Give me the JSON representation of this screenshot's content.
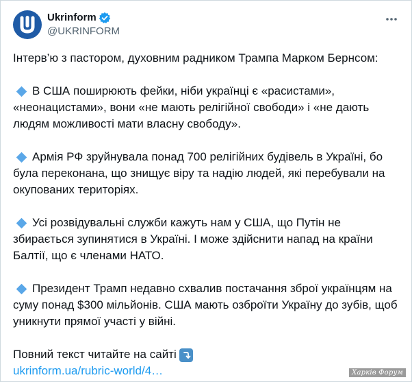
{
  "account": {
    "display_name": "Ukrinform",
    "handle": "@UKRINFORM",
    "avatar_icon": "ukrinform-logo-icon",
    "verified": true,
    "brand_color": "#1f5ba6",
    "verified_color": "#1d9bf0"
  },
  "post": {
    "intro": "Інтерв’ю з пастором, духовним радником Трампа Марком Бернсом:",
    "bullets": [
      "В США поширюють фейки, ніби українці є «расистами», «неонацистами», вони «не мають релігійної свободи» і «не дають людям можливості мати власну свободу».",
      "Армія РФ зруйнувала понад 700 релігійних будівель в Україні, бо була переконана, що знищує віру та надію людей, які перебували на окупованих територіях.",
      "Усі розвідувальні служби кажуть нам у США, що Путін не збирається зупинятися в Україні. І може здійснити напад на країни Балтії, що є членами НАТО.",
      "Президент Трамп недавно схвалив постачання зброї українцям на суму понад $300 мільйонів. США мають озброїти Україну до зубів, щоб уникнути прямої участі у війні."
    ],
    "bullet_icon": "small-blue-diamond-icon",
    "read_more": "Повний текст читайте на сайті",
    "read_more_icon": "arrow-turn-down-icon",
    "link": "ukrinform.ua/rubric-world/4…",
    "link_color": "#1d9bf0"
  },
  "watermark": "Харків Форум"
}
